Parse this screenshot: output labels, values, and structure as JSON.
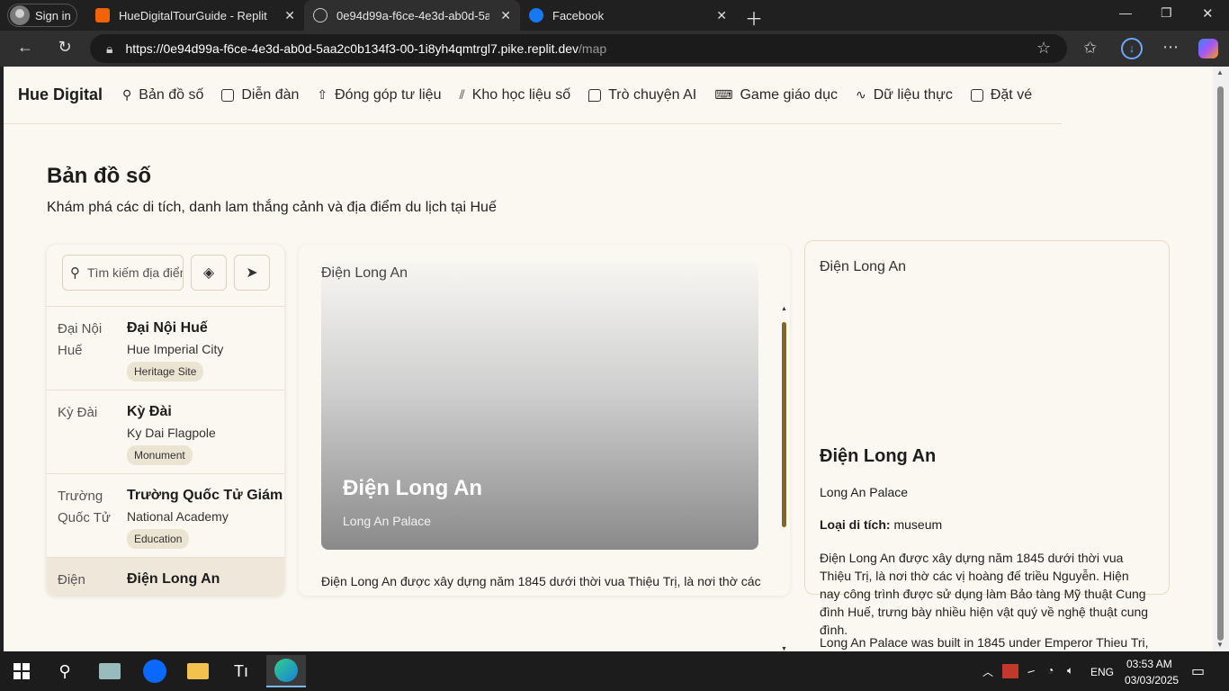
{
  "browser": {
    "profile_label": "Sign in",
    "tabs": [
      {
        "title": "HueDigitalTourGuide - Replit"
      },
      {
        "title": "0e94d99a-f6ce-4e3d-ab0d-5aa2c"
      },
      {
        "title": "Facebook"
      }
    ],
    "url_host": "https://0e94d99a-f6ce-4e3d-ab0d-5aa2c0b134f3-00-1i8yh4qmtrgl7.pike.replit.dev",
    "url_path": "/map"
  },
  "nav": {
    "brand": "Hue Digital",
    "items": [
      {
        "label": "Bản đồ số"
      },
      {
        "label": "Diễn đàn"
      },
      {
        "label": "Đóng góp tư liệu"
      },
      {
        "label": "Kho học liệu số"
      },
      {
        "label": "Trò chuyện AI"
      },
      {
        "label": "Game giáo dục"
      },
      {
        "label": "Dữ liệu thực"
      },
      {
        "label": "Đặt vé"
      }
    ]
  },
  "page": {
    "title": "Bản đồ số",
    "subtitle": "Khám phá các di tích, danh lam thắng cảnh và địa điểm du lịch tại Huế"
  },
  "search": {
    "placeholder": "Tìm kiếm địa điểm"
  },
  "places": [
    {
      "thumb_alt": "Đại Nội Huế",
      "name": "Đại Nội Huế",
      "english": "Hue Imperial City",
      "badge": "Heritage Site"
    },
    {
      "thumb_alt": "Kỳ Đài",
      "name": "Kỳ Đài",
      "english": "Ky Dai Flagpole",
      "badge": "Monument"
    },
    {
      "thumb_alt": "Trường Quốc Tử",
      "name": "Trường Quốc Tử Giám",
      "english": "National Academy",
      "badge": "Education"
    },
    {
      "thumb_alt": "Điện",
      "name": "Điện Long An",
      "english": "",
      "badge": ""
    }
  ],
  "detail": {
    "image_alt": "Điện Long An",
    "title": "Điện Long An",
    "subtitle": "Long An Palace",
    "desc_line": "Điện Long An được xây dựng năm 1845 dưới thời vua Thiệu Trị, là nơi thờ các"
  },
  "info": {
    "image_alt": "Điện Long An",
    "title": "Điện Long An",
    "subtitle": "Long An Palace",
    "type_label": "Loại di tích:",
    "type_value": "museum",
    "description": "Điện Long An được xây dựng năm 1845 dưới thời vua Thiệu Trị, là nơi thờ các vị hoàng đế triều Nguyễn. Hiện nay công trình được sử dụng làm Bảo tàng Mỹ thuật Cung đình Huế, trưng bày nhiều hiện vật quý về nghệ thuật cung đình.",
    "description_en": "Long An Palace was built in 1845 under Emperor Thieu Tri,"
  },
  "taskbar": {
    "lang": "ENG",
    "time": "03:53 AM",
    "date": "03/03/2025"
  }
}
